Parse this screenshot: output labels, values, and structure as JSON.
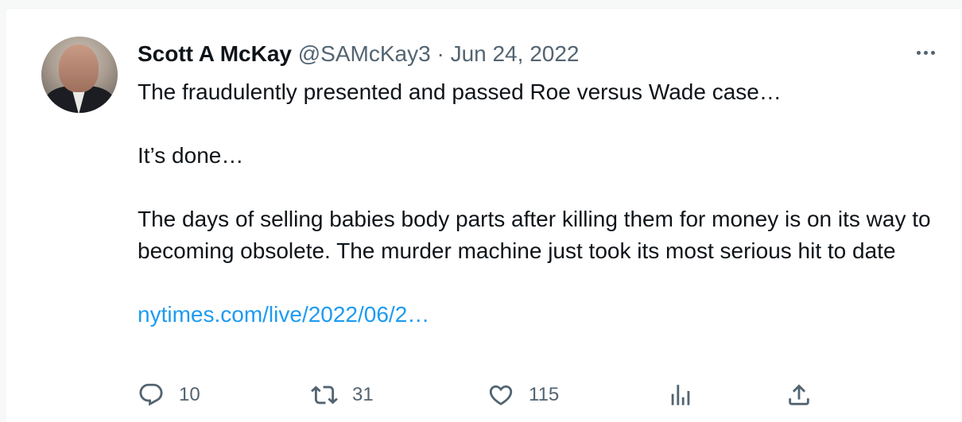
{
  "tweet": {
    "display_name": "Scott A McKay",
    "handle": "@SAMcKay3",
    "separator": "·",
    "date": "Jun 24, 2022",
    "paragraphs": [
      "The fraudulently presented and passed Roe versus Wade case…",
      "It’s done…",
      "The days of selling babies body parts after killing them for money is on its way to becoming obsolete. The murder machine just took its most serious hit to date"
    ],
    "link": "nytimes.com/live/2022/06/2…"
  },
  "actions": {
    "reply_count": "10",
    "retweet_count": "31",
    "like_count": "115"
  },
  "icons": {
    "more": "more-horizontal-icon",
    "reply": "reply-icon",
    "retweet": "retweet-icon",
    "like": "heart-icon",
    "views": "analytics-icon",
    "share": "share-icon"
  },
  "colors": {
    "text": "#0f1419",
    "secondary": "#536471",
    "link": "#1d9bf0",
    "background": "#ffffff"
  }
}
